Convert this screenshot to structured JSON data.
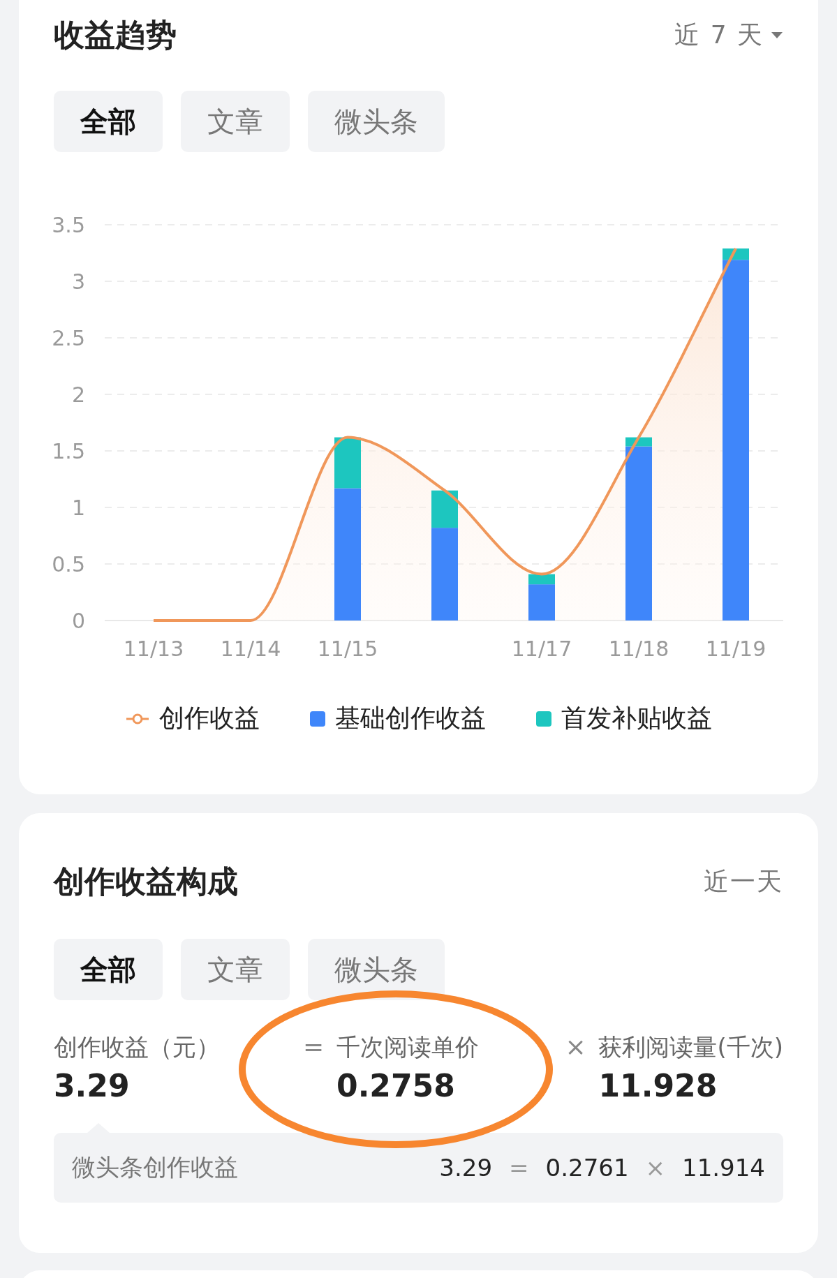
{
  "trend_card": {
    "title": "收益趋势",
    "range": "近 7 天",
    "tabs": [
      {
        "label": "全部",
        "selected": true
      },
      {
        "label": "文章",
        "selected": false
      },
      {
        "label": "微头条",
        "selected": false
      }
    ],
    "chart_data": {
      "type": "bar",
      "stacked": true,
      "grid": true,
      "categories": [
        "11/13",
        "11/14",
        "11/15",
        null,
        "11/17",
        "11/18",
        "11/19"
      ],
      "ylim": [
        0,
        3.5
      ],
      "yticks": [
        0,
        0.5,
        1,
        1.5,
        2,
        2.5,
        3,
        3.5
      ],
      "series": [
        {
          "name": "创作收益",
          "type": "line",
          "color": "#f0975a",
          "values": [
            0,
            0,
            1.62,
            1.15,
            0.41,
            1.62,
            3.29
          ]
        },
        {
          "name": "基础创作收益",
          "type": "bar",
          "color": "#3f86fa",
          "values": [
            0,
            0,
            1.17,
            0.82,
            0.32,
            1.54,
            3.19
          ]
        },
        {
          "name": "首发补贴收益",
          "type": "bar",
          "color": "#1dc6bf",
          "values": [
            0,
            0,
            0.45,
            0.33,
            0.09,
            0.08,
            0.1
          ]
        }
      ]
    }
  },
  "breakdown_card": {
    "title": "创作收益构成",
    "range": "近一天",
    "tabs": [
      {
        "label": "全部",
        "selected": true
      },
      {
        "label": "文章",
        "selected": false
      },
      {
        "label": "微头条",
        "selected": false
      }
    ],
    "metrics": [
      {
        "label": "创作收益（元）",
        "value": "3.29"
      },
      {
        "operator": "=",
        "label": "千次阅读单价",
        "value": "0.2758"
      },
      {
        "operator": "×",
        "label": "获利阅读量(千次)",
        "value": "11.928"
      }
    ],
    "detail": {
      "label": "微头条创作收益",
      "parts": [
        {
          "value": "3.29"
        },
        {
          "operator": "=",
          "value": "0.2761"
        },
        {
          "operator": "×",
          "value": "11.914"
        }
      ]
    }
  }
}
